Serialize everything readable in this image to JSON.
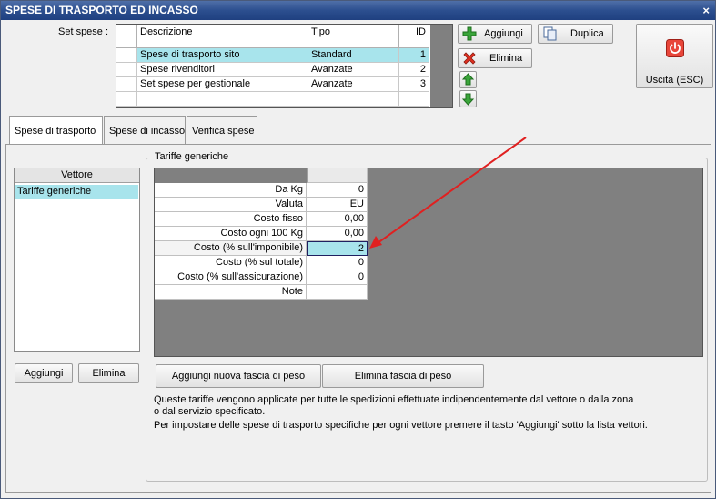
{
  "window": {
    "title": "SPESE DI TRASPORTO ED INCASSO",
    "close_glyph": "×"
  },
  "set_spese": {
    "label": "Set spese :",
    "columns": [
      "Descrizione",
      "Tipo",
      "ID"
    ],
    "rows": [
      {
        "descrizione": "Spese di trasporto sito",
        "tipo": "Standard",
        "id": "1"
      },
      {
        "descrizione": "Spese rivenditori",
        "tipo": "Avanzate",
        "id": "2"
      },
      {
        "descrizione": "Set spese per gestionale",
        "tipo": "Avanzate",
        "id": "3"
      }
    ]
  },
  "toolbar": {
    "aggiungi_label": "Aggiungi",
    "elimina_label": "Elimina",
    "duplica_label": "Duplica",
    "uscita_label": "Uscita (ESC)"
  },
  "tabs": [
    {
      "label": "Spese di trasporto"
    },
    {
      "label": "Spese di incasso"
    },
    {
      "label": "Verifica spese"
    }
  ],
  "vettore": {
    "header": "Vettore",
    "items": [
      "Tariffe generiche"
    ],
    "aggiungi_label": "Aggiungi",
    "elimina_label": "Elimina"
  },
  "tariffe": {
    "group_title": "Tariffe generiche",
    "rows": [
      {
        "label": "Da Kg",
        "value": "0"
      },
      {
        "label": "Valuta",
        "value": "EU"
      },
      {
        "label": "Costo fisso",
        "value": "0,00"
      },
      {
        "label": "Costo ogni 100 Kg",
        "value": "0,00"
      },
      {
        "label": "Costo (% sull'imponibile)",
        "value": "2"
      },
      {
        "label": "Costo (% sul totale)",
        "value": "0"
      },
      {
        "label": "Costo (% sull'assicurazione)",
        "value": "0"
      },
      {
        "label": "Note",
        "value": ""
      }
    ],
    "aggiungi_fascia_label": "Aggiungi nuova fascia di peso",
    "elimina_fascia_label": "Elimina fascia di peso",
    "info_lines": [
      "Queste tariffe vengono applicate per tutte le spedizioni effettuate indipendentemente dal vettore o dalla zona",
      "o dal servizio specificato.",
      "Per impostare delle spese di trasporto specifiche per ogni vettore premere il tasto 'Aggiungi' sotto la lista vettori."
    ]
  },
  "colors": {
    "selection": "#a8e4ec",
    "arrow": "#e02020",
    "titlebar": "#2c4f8f"
  }
}
